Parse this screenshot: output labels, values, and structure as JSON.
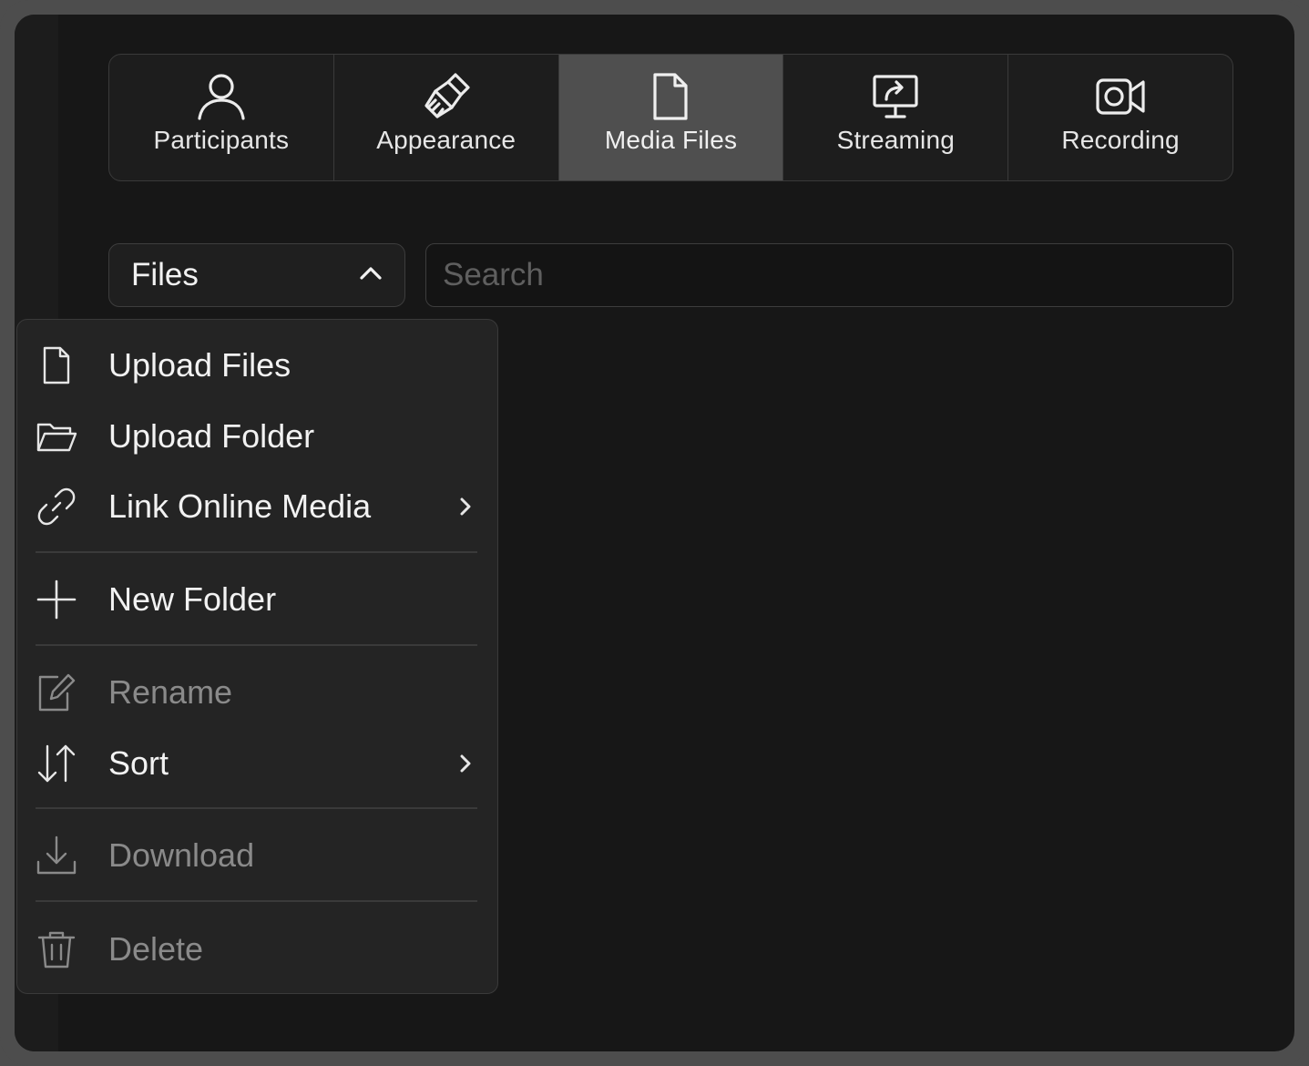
{
  "tabs": [
    {
      "label": "Participants",
      "icon": "person-icon",
      "active": false
    },
    {
      "label": "Appearance",
      "icon": "paintbrush-icon",
      "active": false
    },
    {
      "label": "Media Files",
      "icon": "file-icon",
      "active": true
    },
    {
      "label": "Streaming",
      "icon": "monitor-share-icon",
      "active": false
    },
    {
      "label": "Recording",
      "icon": "video-camera-icon",
      "active": false
    }
  ],
  "files_select": {
    "value": "Files",
    "icon": "chevron-up-icon"
  },
  "search": {
    "placeholder": "Search",
    "value": ""
  },
  "menu": {
    "items": [
      {
        "label": "Upload Files",
        "icon": "file-icon",
        "disabled": false,
        "submenu": false
      },
      {
        "label": "Upload Folder",
        "icon": "folder-open-icon",
        "disabled": false,
        "submenu": false
      },
      {
        "label": "Link Online Media",
        "icon": "link-icon",
        "disabled": false,
        "submenu": true
      },
      {
        "label": "New Folder",
        "icon": "plus-icon",
        "disabled": false,
        "submenu": false
      },
      {
        "label": "Rename",
        "icon": "edit-icon",
        "disabled": true,
        "submenu": false
      },
      {
        "label": "Sort",
        "icon": "sort-icon",
        "disabled": false,
        "submenu": true
      },
      {
        "label": "Download",
        "icon": "download-icon",
        "disabled": true,
        "submenu": false
      },
      {
        "label": "Delete",
        "icon": "trash-icon",
        "disabled": true,
        "submenu": false
      }
    ]
  },
  "colors": {
    "background": "#171717",
    "active_tab": "#4f4f4f",
    "menu_bg": "#242424",
    "text": "#f2f2f2",
    "disabled_text": "#8a8a8a"
  }
}
